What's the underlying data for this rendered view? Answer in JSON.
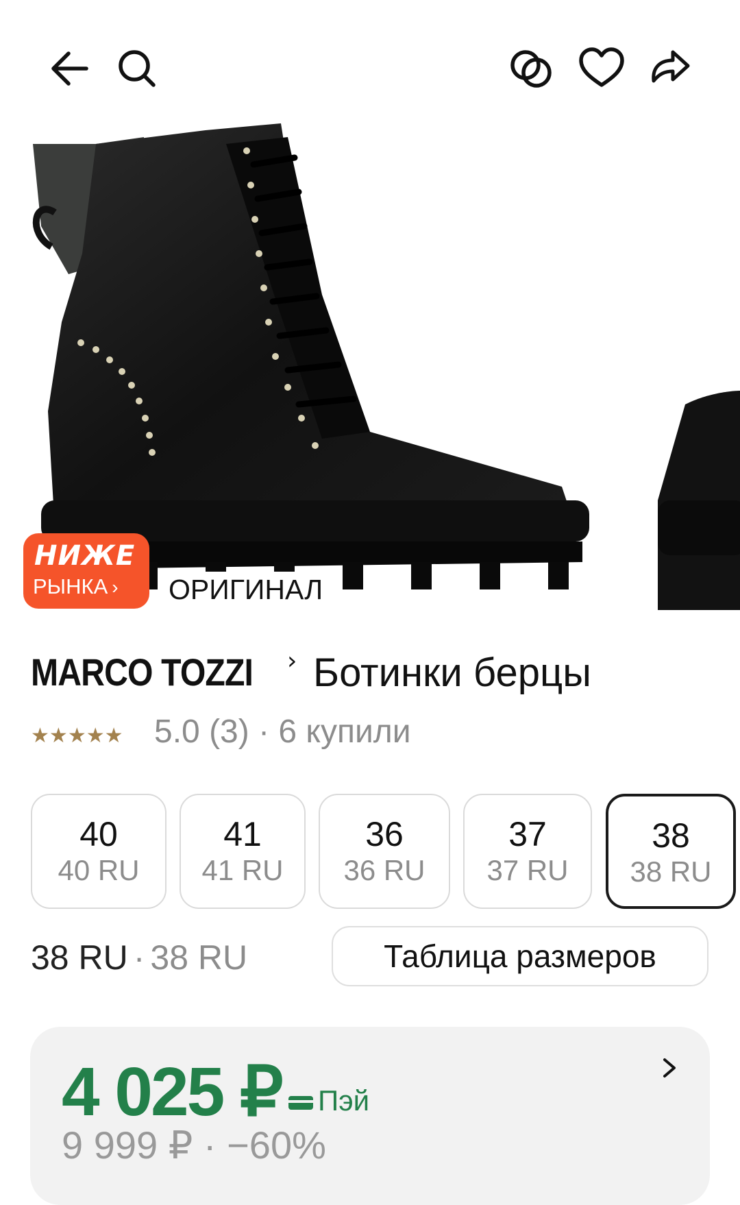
{
  "topbar": {
    "icons": [
      "back-arrow-icon",
      "search-icon",
      "compare-icon",
      "heart-icon",
      "share-icon"
    ]
  },
  "badges": {
    "lower_line1": "НИЖЕ",
    "lower_line2": "РЫНКА",
    "lower_chevron": "›",
    "original": "ОРИГИНАЛ",
    "accent_color": "#f5542a"
  },
  "product": {
    "brand": "MARCO TOZZI",
    "brand_chevron": "›",
    "name": "Ботинки берцы"
  },
  "rating": {
    "stars": 5,
    "star_color": "#a3824e",
    "text": "5.0 (3) · 6 купили"
  },
  "sizes": [
    {
      "main": "40",
      "sub": "40 RU",
      "selected": false
    },
    {
      "main": "41",
      "sub": "41 RU",
      "selected": false
    },
    {
      "main": "36",
      "sub": "36 RU",
      "selected": false
    },
    {
      "main": "37",
      "sub": "37 RU",
      "selected": false
    },
    {
      "main": "38",
      "sub": "38 RU",
      "selected": true
    }
  ],
  "size_summary": {
    "primary": "38 RU",
    "separator": "·",
    "secondary": "38 RU"
  },
  "size_table_label": "Таблица размеров",
  "price": {
    "current": "4 025 ₽",
    "pay_label": "Пэй",
    "old_partial": "9 999 ₽ · −60%",
    "color": "#23804a"
  }
}
